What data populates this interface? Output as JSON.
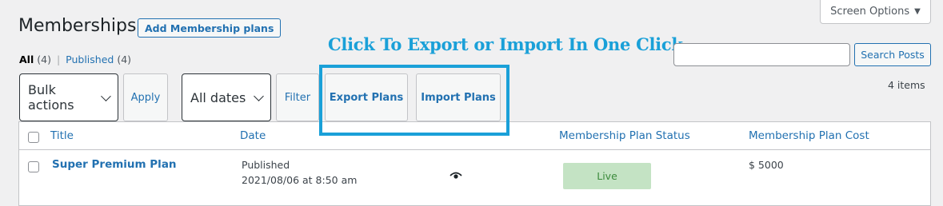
{
  "screen_options": {
    "label": "Screen Options"
  },
  "page": {
    "title": "Memberships",
    "add_button": "Add Membership plans"
  },
  "views": {
    "all": {
      "label": "All",
      "count": "(4)"
    },
    "separator": "|",
    "published": {
      "label": "Published",
      "count": "(4)"
    }
  },
  "promo": {
    "text": "Click To Export or Import In One Click",
    "color": "#1aa0d8"
  },
  "search": {
    "value": "",
    "button": "Search Posts"
  },
  "toolbar": {
    "bulk_actions": "Bulk actions",
    "apply": "Apply",
    "dates": "All dates",
    "filter": "Filter",
    "export": "Export Plans",
    "import": "Import Plans",
    "items_count": "4 items"
  },
  "table": {
    "headers": {
      "title": "Title",
      "date": "Date",
      "status": "Membership Plan Status",
      "cost": "Membership Plan Cost"
    },
    "rows": [
      {
        "title": "Super Premium Plan",
        "date_status": "Published",
        "date_value": "2021/08/06 at 8:50 am",
        "icon": "eye-icon",
        "status": "Live",
        "cost": "$ 5000"
      }
    ]
  }
}
